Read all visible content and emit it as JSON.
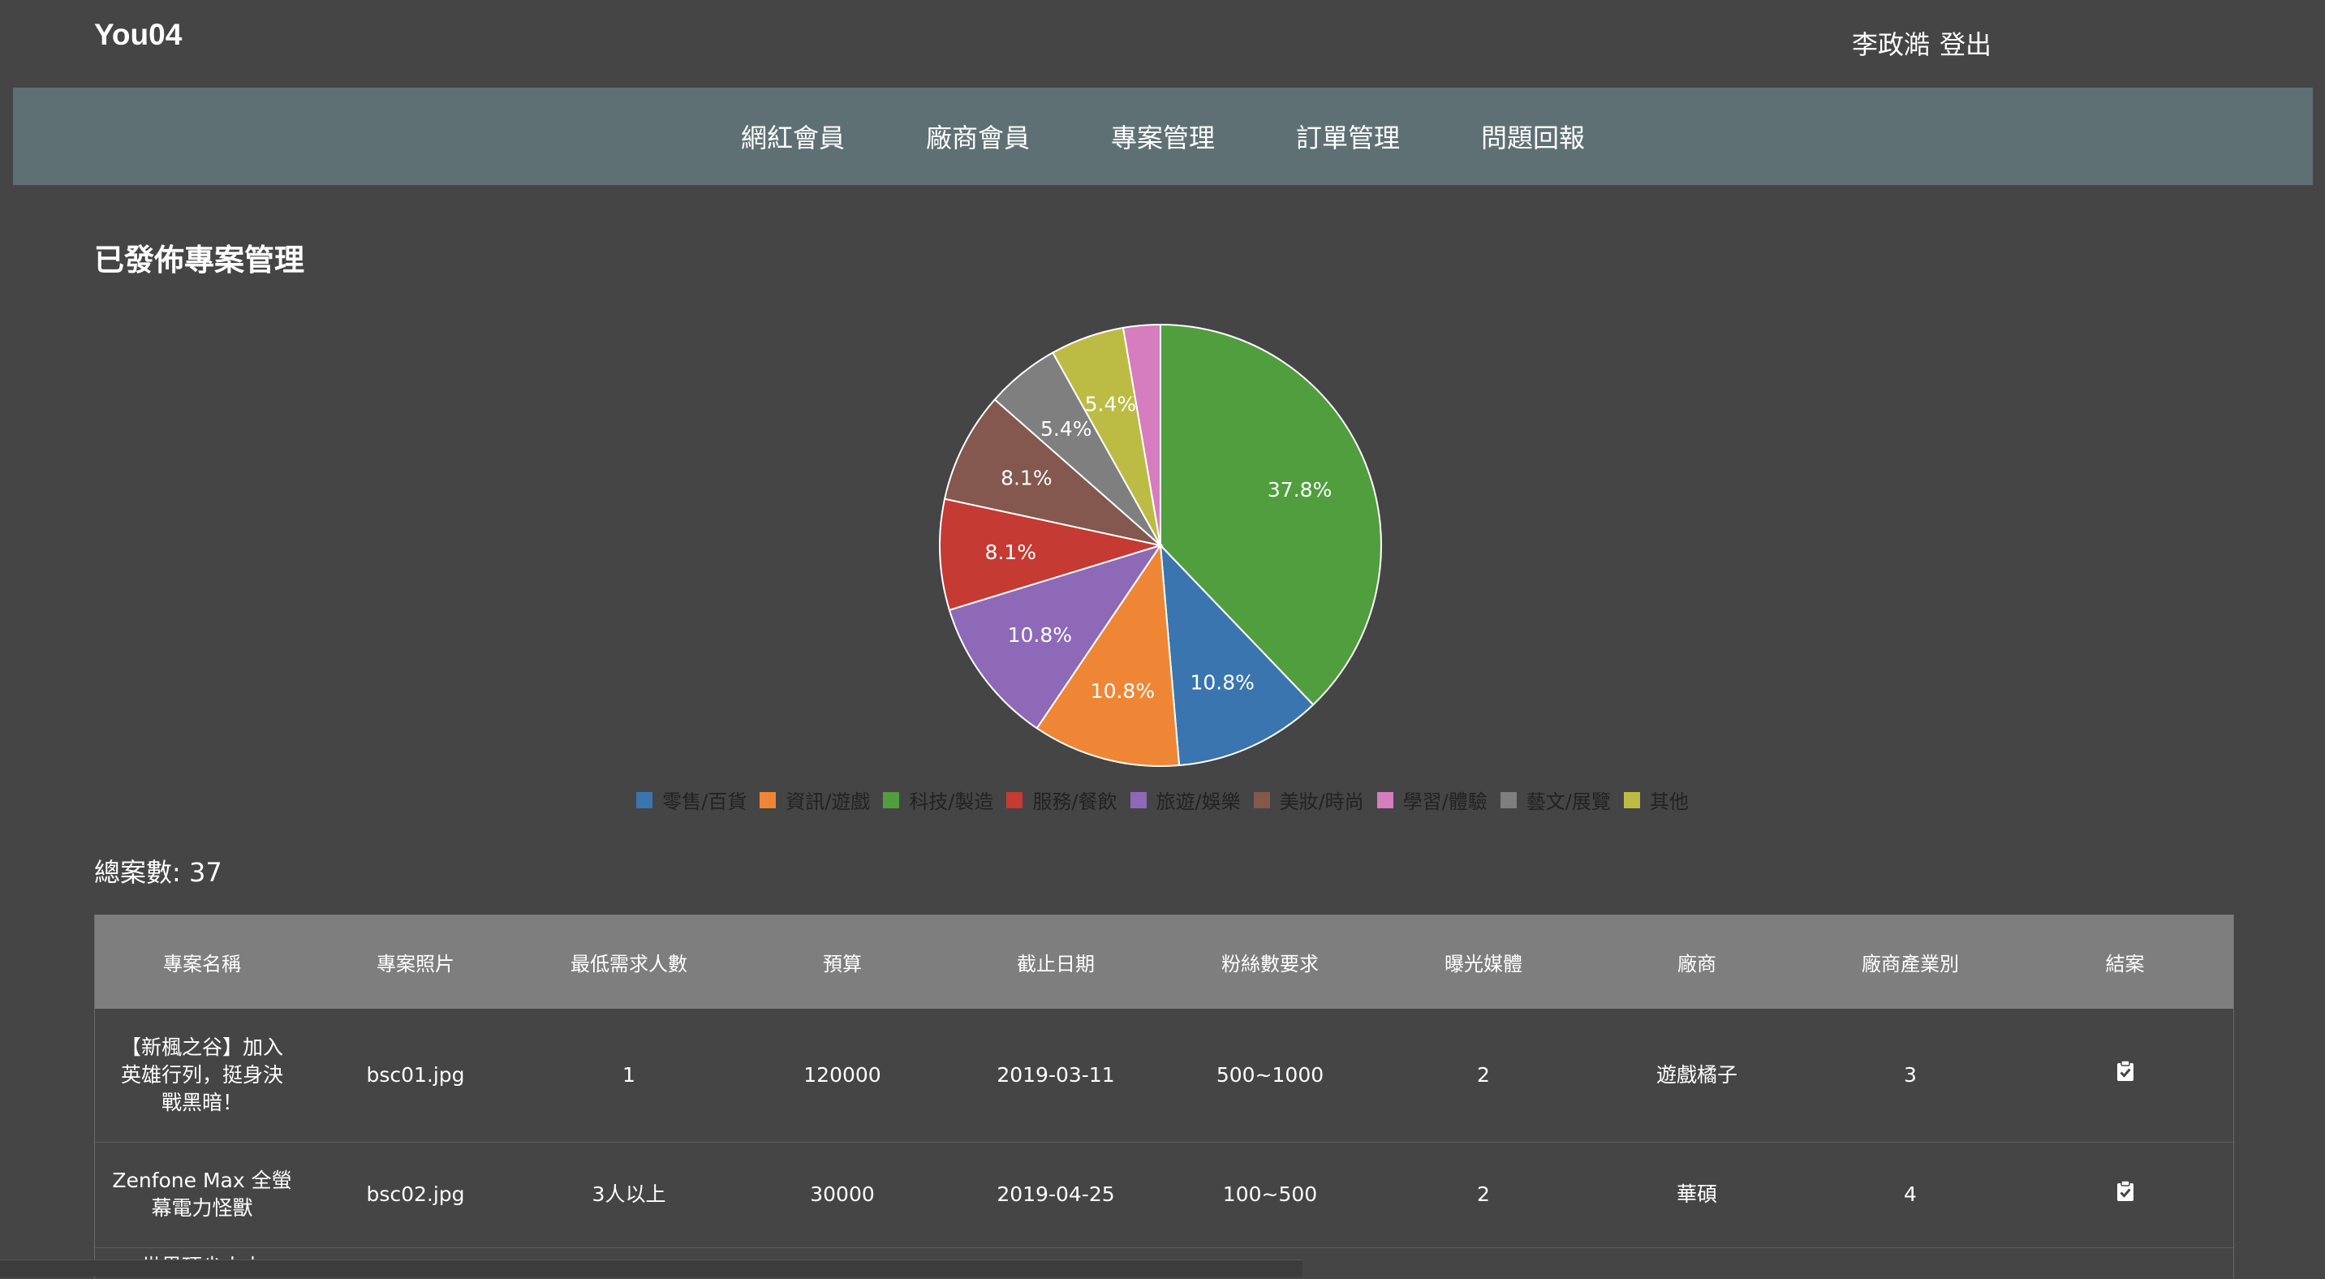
{
  "header": {
    "brand": "You04",
    "user_name": "李政澔",
    "logout_label": "登出"
  },
  "nav": {
    "items": [
      "網紅會員",
      "廠商會員",
      "專案管理",
      "訂單管理",
      "問題回報"
    ]
  },
  "page": {
    "title": "已發佈專案管理",
    "total_label": "總案數: 37"
  },
  "chart_data": {
    "type": "pie",
    "labels": [
      "零售/百貨",
      "資訊/遊戲",
      "科技/製造",
      "服務/餐飲",
      "旅遊/娛樂",
      "美妝/時尚",
      "學習/體驗",
      "藝文/展覽",
      "其他"
    ],
    "values": [
      10.8,
      10.8,
      37.8,
      8.1,
      10.8,
      8.1,
      2.7,
      5.4,
      5.4
    ],
    "colors": [
      "#3b75af",
      "#ef8636",
      "#519e3e",
      "#c53a32",
      "#8d69b8",
      "#84584e",
      "#d57dbf",
      "#7f7f7f",
      "#bcbc45"
    ],
    "legend_position": "bottom"
  },
  "table": {
    "headers": [
      "專案名稱",
      "專案照片",
      "最低需求人數",
      "預算",
      "截止日期",
      "粉絲數要求",
      "曝光媒體",
      "廠商",
      "廠商產業別",
      "結案"
    ],
    "rows": [
      [
        "【新楓之谷】加入英雄行列，挺身決戰黑暗！",
        "bsc01.jpg",
        "1",
        "120000",
        "2019-03-11",
        "500~1000",
        "2",
        "遊戲橘子",
        "3"
      ],
      [
        "Zenfone Max 全螢幕電力怪獸",
        "bsc02.jpg",
        "3人以上",
        "30000",
        "2019-04-25",
        "100~500",
        "2",
        "華碩",
        "4"
      ],
      [
        "世界頂尖人士",
        "",
        "",
        "",
        "",
        "",
        "",
        "",
        ""
      ]
    ]
  }
}
